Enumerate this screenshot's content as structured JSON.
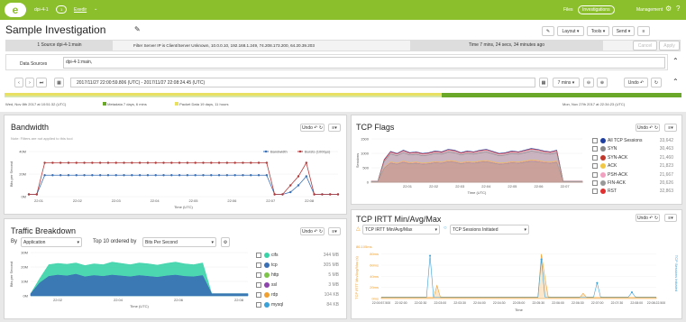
{
  "topbar": {
    "logo": "e",
    "instance": "dpi-4-1",
    "instance_badge": "1",
    "user": "Exedir",
    "files": "Files",
    "investigations": "Investigations",
    "management": "Management"
  },
  "page": {
    "title": "Sample Investigation",
    "layout": "Layout",
    "tools": "Tools",
    "send": "Send"
  },
  "filters": {
    "source": "1 Source dpi-4-1:main",
    "filter": "Filter Server IP is Client/Server Unknown, 10.0.0.10, 192.168.1.249, 74.208.173.200, 64.20.39.203",
    "time": "Time 7 mins, 24 secs, 34 minutes ago",
    "cancel": "Cancel",
    "apply": "Apply"
  },
  "datasources": {
    "label": "Data Sources",
    "value": "dpi-4-1:main,"
  },
  "timebar": {
    "range": "2017/11/27 22:00:59.806 (UTC) - 2017/11/27 22:08:24.45 (UTC)",
    "duration": "7 mins",
    "undo": "Undo"
  },
  "timeline": {
    "start": "Wed, Nov 8th 2017 at 10:51:32 (UTC)",
    "metadata": "Metadata 7 days, 6 mins",
    "packet": "Packet Data 19 days, 11 hours",
    "end": "Mon, Nov 27th 2017 at 22:34:23 (UTC)"
  },
  "bandwidth": {
    "title": "Bandwidth",
    "note": "Note: Filters are not applied to this tool",
    "undo": "Undo",
    "chart_data": {
      "type": "line",
      "x": [
        "22:01",
        "22:02",
        "22:03",
        "22:04",
        "22:05",
        "22:06",
        "22:07",
        "22:08"
      ],
      "ylabel": "Bits per Second",
      "xlabel": "Time (UTC)",
      "yticks": [
        "0M",
        "20M",
        "40M"
      ],
      "ylim": [
        0,
        40
      ],
      "series": [
        {
          "name": "Bandwidth",
          "color": "#3a6fb5",
          "values": [
            2,
            2,
            19,
            19,
            19,
            19,
            19,
            19,
            19,
            19,
            19,
            19,
            19,
            19,
            19,
            19,
            19,
            19,
            19,
            19,
            19,
            19,
            19,
            19,
            19,
            19,
            19,
            19,
            19,
            19,
            19,
            2,
            2,
            4,
            10,
            18,
            2,
            2,
            2,
            2
          ]
        },
        {
          "name": "Bursts (1000µs)",
          "color": "#b33a3a",
          "values": [
            2,
            2,
            30,
            30,
            30,
            30,
            30,
            30,
            30,
            30,
            30,
            30,
            30,
            30,
            30,
            30,
            30,
            30,
            30,
            30,
            30,
            30,
            30,
            30,
            30,
            30,
            30,
            30,
            30,
            30,
            30,
            2,
            2,
            10,
            18,
            30,
            2,
            2,
            2,
            2
          ]
        }
      ]
    }
  },
  "tcpflags": {
    "title": "TCP Flags",
    "undo": "Undo",
    "chart_data": {
      "type": "area",
      "x": [
        "22:01",
        "22:02",
        "22:03",
        "22:04",
        "22:05",
        "22:06",
        "22:07"
      ],
      "xlabel": "Time (UTC)",
      "ylabel": "Sessions",
      "yticks": [
        "0",
        "500",
        "1000",
        "1500"
      ],
      "ylim": [
        0,
        1500
      ]
    },
    "legend": [
      {
        "name": "All TCP Sessions",
        "value": "33,642",
        "color": "#1f3fa0"
      },
      {
        "name": "SYN",
        "value": "30,463",
        "color": "#888888"
      },
      {
        "name": "SYN-ACK",
        "value": "21,460",
        "color": "#c0392b"
      },
      {
        "name": "ACK",
        "value": "21,823",
        "color": "#f2c744"
      },
      {
        "name": "PSH-ACK",
        "value": "21,667",
        "color": "#f2a0c0"
      },
      {
        "name": "FIN-ACK",
        "value": "20,626",
        "color": "#999999"
      },
      {
        "name": "RST",
        "value": "32,863",
        "color": "#e03030"
      }
    ]
  },
  "traffic": {
    "title": "Traffic Breakdown",
    "by_label": "By",
    "by_value": "Application",
    "top_label": "Top 10 ordered by",
    "order_value": "Bits Per Second",
    "undo": "Undo",
    "chart_data": {
      "type": "area",
      "x": [
        "22:02",
        "22:04",
        "22:06",
        "22:08"
      ],
      "xlabel": "Time (UTC)",
      "ylabel": "Bits per Second",
      "yticks": [
        "0M",
        "10M",
        "20M",
        "30M"
      ],
      "ylim": [
        0,
        30
      ]
    },
    "legend": [
      {
        "name": "cifs",
        "value": "344 MB",
        "color": "#3ad3a8"
      },
      {
        "name": "tcp",
        "value": "305 MB",
        "color": "#3a6fb5"
      },
      {
        "name": "http",
        "value": "5 MB",
        "color": "#7cc44a"
      },
      {
        "name": "ssl",
        "value": "3 MB",
        "color": "#8e44ad"
      },
      {
        "name": "rdp",
        "value": "104 KB",
        "color": "#f0a030"
      },
      {
        "name": "mysql",
        "value": "84 KB",
        "color": "#3aa0d8"
      }
    ]
  },
  "irtt": {
    "title": "TCP IRTT Min/Avg/Max",
    "undo": "Undo",
    "metric1": "TCP IRTT Min/Avg/Max",
    "metric2": "TCP Sessions Initiated",
    "chart_data": {
      "type": "line",
      "x": [
        "22:00:57.500",
        "22:02:00",
        "22:02:30",
        "22:03:00",
        "22:03:30",
        "22:04:00",
        "22:04:30",
        "22:05:00",
        "22:05:30",
        "22:06:00",
        "22:06:30",
        "22:07:00",
        "22:07:30",
        "22:08:00",
        "22:08:22.500"
      ],
      "xlabel": "Time",
      "ylabel": "TCP IRTT Min/Avg/Max (s)",
      "y2label": "TCP Sessions Initiated",
      "yticks": [
        "0ms",
        "20ms",
        "40ms",
        "60ms",
        "80ms"
      ],
      "y_max_label": "86.105ms"
    }
  }
}
